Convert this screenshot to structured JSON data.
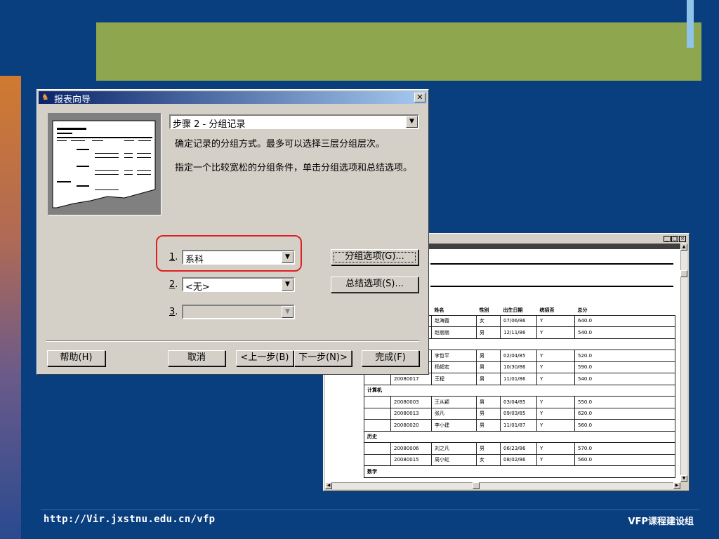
{
  "slide": {
    "footer_url": "http://Vir.jxstnu.edu.cn/vfp",
    "footer_org": "VFP课程建设组"
  },
  "dialog": {
    "title": "报表向导",
    "step_label": "步骤 2 - 分组记录",
    "description1": "确定记录的分组方式。最多可以选择三层分组层次。",
    "description2": "指定一个比较宽松的分组条件，单击分组选项和总结选项。",
    "group_fields": [
      {
        "label": "1",
        "value": "系科"
      },
      {
        "label": "2",
        "value": "<无>"
      },
      {
        "label": "3",
        "value": ""
      }
    ],
    "buttons": {
      "group_options": "分组选项(G)...",
      "summary_options": "总结选项(S)...",
      "help": "帮助(H)",
      "cancel": "取消",
      "prev": "<上一步(B)",
      "next": "下一步(N)>",
      "finish": "完成(F)"
    }
  },
  "preview": {
    "headers": [
      "姓名",
      "性别",
      "出生日期",
      "统招否",
      "总分"
    ],
    "rows": [
      {
        "type": "data",
        "cells": [
          "",
          "赵海霞",
          "女",
          "07/06/86",
          "Y",
          "640.0"
        ]
      },
      {
        "type": "data",
        "cells": [
          "",
          "赵丽丽",
          "男",
          "12/11/86",
          "Y",
          "540.0"
        ]
      },
      {
        "type": "group",
        "cells": [
          ""
        ]
      },
      {
        "type": "data",
        "cells": [
          "",
          "李哲平",
          "男",
          "02/04/85",
          "Y",
          "520.0"
        ]
      },
      {
        "type": "data",
        "cells": [
          "",
          "杨超宏",
          "男",
          "10/30/86",
          "Y",
          "590.0"
        ]
      },
      {
        "type": "data",
        "cells": [
          "20080017",
          "王程",
          "男",
          "11/01/86",
          "Y",
          "540.0"
        ]
      },
      {
        "type": "group",
        "cells": [
          "计算机"
        ]
      },
      {
        "type": "data",
        "cells": [
          "20080003",
          "王从颖",
          "男",
          "03/04/85",
          "Y",
          "550.0"
        ]
      },
      {
        "type": "data",
        "cells": [
          "20080013",
          "张凡",
          "男",
          "09/03/85",
          "Y",
          "620.0"
        ]
      },
      {
        "type": "data",
        "cells": [
          "20080020",
          "李小建",
          "男",
          "11/01/87",
          "Y",
          "560.0"
        ]
      },
      {
        "type": "group",
        "cells": [
          "历史"
        ]
      },
      {
        "type": "data",
        "cells": [
          "20080006",
          "刘之凡",
          "男",
          "06/23/86",
          "Y",
          "570.0"
        ]
      },
      {
        "type": "data",
        "cells": [
          "20080015",
          "周小虹",
          "女",
          "08/02/86",
          "Y",
          "560.0"
        ]
      },
      {
        "type": "group",
        "cells": [
          "数学"
        ]
      }
    ]
  }
}
